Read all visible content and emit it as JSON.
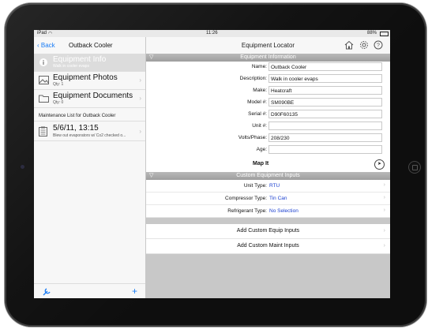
{
  "status": {
    "device": "iPad",
    "wifi_icon": "wifi-icon",
    "time": "11:26",
    "battery": "88%"
  },
  "left": {
    "back_label": "Back",
    "title": "Outback Cooler",
    "items": [
      {
        "title": "Equipment Info",
        "sub": "Walk in cooler evaps",
        "icon": "info-icon"
      },
      {
        "title": "Equipment Photos",
        "sub": "Qty: 1",
        "icon": "photo-icon"
      },
      {
        "title": "Equipment Documents",
        "sub": "Qty: 0",
        "icon": "folder-icon"
      }
    ],
    "maintenance_caption": "Maintenance List for Outback Cooler",
    "maintenance_item": {
      "title": "5/6/11, 13:15",
      "sub": "Blew out evaporators w/ Co2 checked o..."
    },
    "footer_left_icon": "settings-icon",
    "footer_right_icon": "+"
  },
  "right": {
    "title": "Equipment Locator",
    "equipment_info_header": "Equipment Information",
    "fields": [
      {
        "label": "Name:",
        "value": "Outback Cooler"
      },
      {
        "label": "Description:",
        "value": "Walk in cooler evaps"
      },
      {
        "label": "Make:",
        "value": "Heatcraft"
      },
      {
        "label": "Model #:",
        "value": "SM090BE"
      },
      {
        "label": "Serial #:",
        "value": "D90F60135"
      },
      {
        "label": "Unit #:",
        "value": ""
      },
      {
        "label": "Volts/Phase:",
        "value": "208/230"
      },
      {
        "label": "Age:",
        "value": ""
      }
    ],
    "map_it_label": "Map It",
    "custom_header": "Custom Equipment Inputs",
    "custom": [
      {
        "label": "Unit Type:",
        "value": "RTU"
      },
      {
        "label": "Compressor Type:",
        "value": "Tin Can"
      },
      {
        "label": "Refrigerant Type:",
        "value": "No Selection"
      }
    ],
    "add_equip": "Add Custom Equip Inputs",
    "add_maint": "Add Custom Maint Inputs"
  }
}
